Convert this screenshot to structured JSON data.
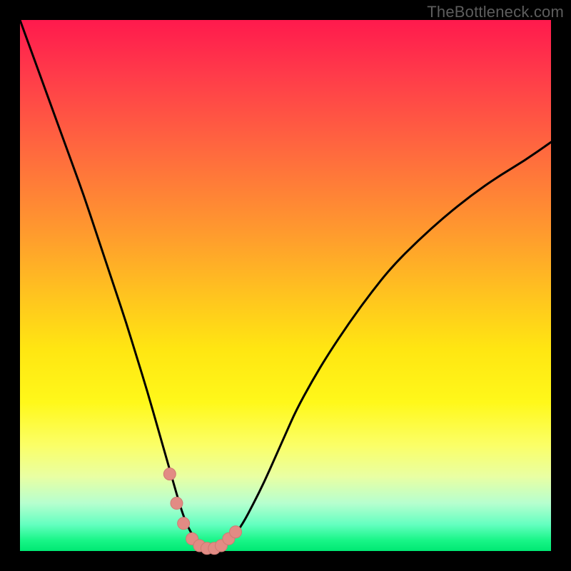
{
  "watermark": "TheBottleneck.com",
  "colors": {
    "frame": "#000000",
    "curve": "#000000",
    "marker_fill": "#e28b84",
    "marker_stroke": "#cf7a72"
  },
  "chart_data": {
    "type": "line",
    "title": "",
    "xlabel": "",
    "ylabel": "",
    "xlim": [
      0,
      100
    ],
    "ylim": [
      0,
      100
    ],
    "grid": false,
    "legend": false,
    "x": [
      0,
      2,
      4,
      6,
      8,
      10,
      12,
      14,
      16,
      18,
      20,
      22,
      24,
      26,
      28,
      30,
      31,
      32,
      33,
      34,
      35,
      36,
      38,
      40,
      42,
      44,
      46,
      48,
      50,
      52,
      55,
      58,
      62,
      66,
      70,
      75,
      80,
      85,
      90,
      95,
      100
    ],
    "y": [
      100,
      94.5,
      89,
      83.5,
      78,
      72.5,
      67,
      61,
      55,
      49,
      43,
      36.5,
      30,
      23,
      16,
      9,
      6,
      3.8,
      2.2,
      1.2,
      0.6,
      0.4,
      0.9,
      2.4,
      5.2,
      9,
      13,
      17.5,
      22,
      26.5,
      32,
      37,
      43,
      48.5,
      53.5,
      58.5,
      63,
      67,
      70.5,
      73.5,
      77
    ],
    "markers": {
      "x": [
        28.2,
        29.5,
        30.8,
        32.4,
        33.8,
        35.2,
        36.6,
        37.9,
        39.3,
        40.6
      ],
      "y": [
        14.5,
        9.0,
        5.2,
        2.3,
        1.0,
        0.5,
        0.5,
        1.0,
        2.3,
        3.6
      ]
    },
    "annotations": []
  }
}
